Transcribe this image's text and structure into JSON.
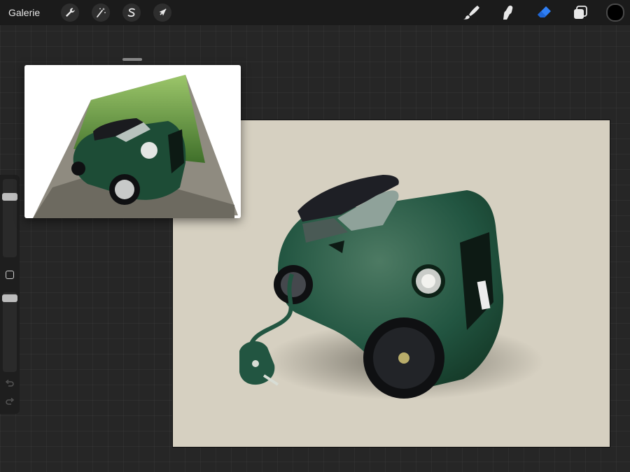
{
  "topbar": {
    "gallery_label": "Galerie",
    "left_tools": [
      {
        "name": "actions",
        "icon": "wrench-icon"
      },
      {
        "name": "adjustments",
        "icon": "magic-wand-icon"
      },
      {
        "name": "selection",
        "icon": "selection-s-icon"
      },
      {
        "name": "transform",
        "icon": "arrow-cursor-icon"
      }
    ],
    "right_tools": [
      {
        "name": "paint",
        "icon": "brush-icon",
        "active": false
      },
      {
        "name": "smudge",
        "icon": "smudge-finger-icon",
        "active": false
      },
      {
        "name": "erase",
        "icon": "eraser-icon",
        "active": true
      },
      {
        "name": "layers",
        "icon": "layers-icon",
        "active": false
      }
    ],
    "current_color": "#000000",
    "active_tool_color": "#2f7ff5"
  },
  "sidebar": {
    "brush_size": 0.75,
    "opacity": 1.0
  },
  "canvas": {
    "background_color": "#d6d0c1",
    "subject": "green-mini-cooper-painting"
  },
  "reference_window": {
    "subject": "green-mini-cooper-photo"
  }
}
